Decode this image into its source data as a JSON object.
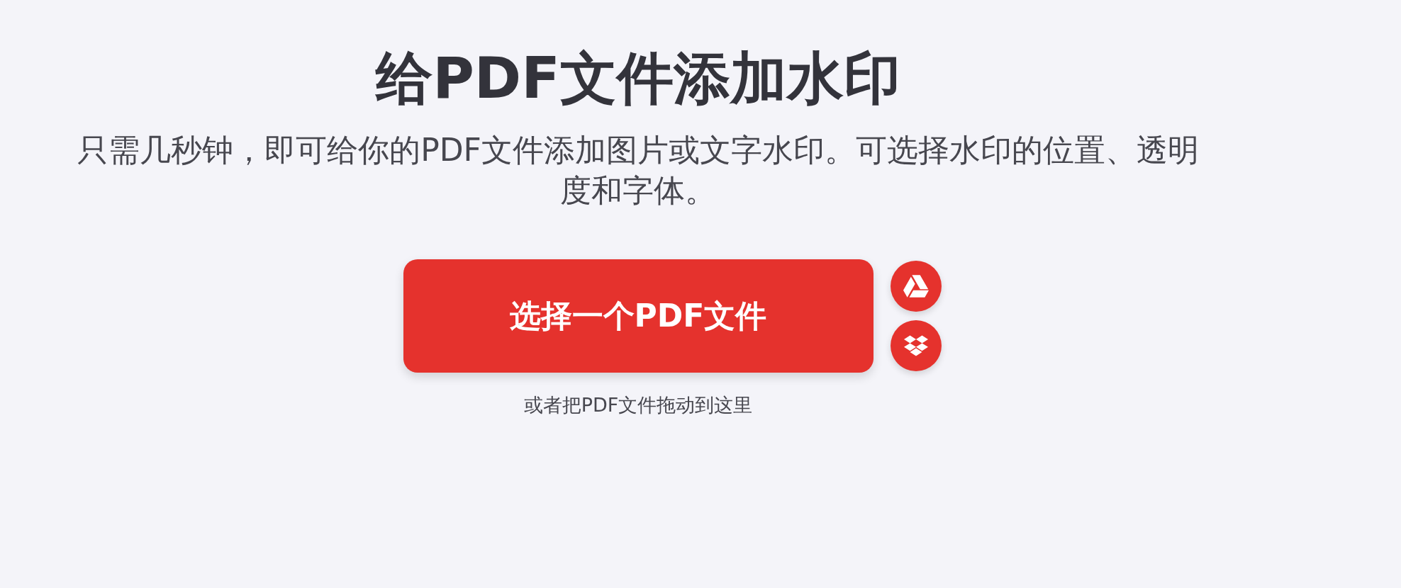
{
  "title": "给PDF文件添加水印",
  "description": "只需几秒钟，即可给你的PDF文件添加图片或文字水印。可选择水印的位置、透明度和字体。",
  "upload": {
    "button": "选择一个PDF文件",
    "drop_hint": "或者把PDF文件拖动到这里"
  }
}
